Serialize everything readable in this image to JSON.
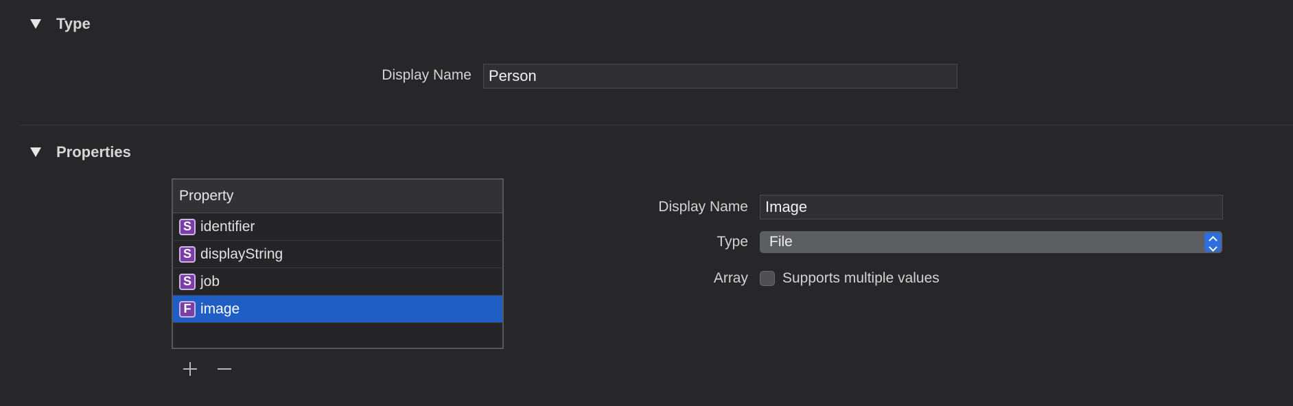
{
  "type_section": {
    "title": "Type",
    "display_name_label": "Display Name",
    "display_name_value": "Person"
  },
  "properties_section": {
    "title": "Properties",
    "table": {
      "header": "Property",
      "rows": [
        {
          "badge": "S",
          "name": "identifier",
          "selected": false
        },
        {
          "badge": "S",
          "name": "displayString",
          "selected": false
        },
        {
          "badge": "S",
          "name": "job",
          "selected": false
        },
        {
          "badge": "F",
          "name": "image",
          "selected": true
        }
      ]
    },
    "add_icon": "plus-icon",
    "remove_icon": "minus-icon",
    "detail": {
      "display_name_label": "Display Name",
      "display_name_value": "Image",
      "type_label": "Type",
      "type_value": "File",
      "array_label": "Array",
      "array_checkbox_label": "Supports multiple values",
      "array_checked": false
    }
  },
  "colors": {
    "background": "#272729",
    "selection": "#1f5ec4",
    "badge": "#7a3ea6",
    "stepper": "#2d6fe0"
  }
}
